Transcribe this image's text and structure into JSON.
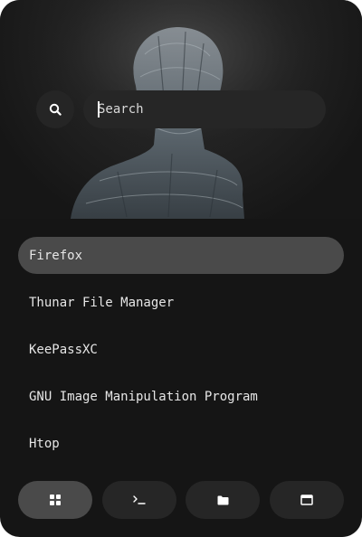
{
  "search": {
    "placeholder": "Search",
    "value": "",
    "icon": "search-icon"
  },
  "apps": [
    {
      "label": "Firefox",
      "selected": true
    },
    {
      "label": "Thunar File Manager",
      "selected": false
    },
    {
      "label": "KeePassXC",
      "selected": false
    },
    {
      "label": "GNU Image Manipulation Program",
      "selected": false
    },
    {
      "label": "Htop",
      "selected": false
    }
  ],
  "dock": [
    {
      "icon": "apps-grid-icon",
      "active": true
    },
    {
      "icon": "terminal-icon",
      "active": false
    },
    {
      "icon": "folder-icon",
      "active": false
    },
    {
      "icon": "window-icon",
      "active": false
    }
  ],
  "colors": {
    "background": "#151515",
    "selected": "#4a4a4a",
    "button": "#262626",
    "text": "#e6e6e6"
  }
}
